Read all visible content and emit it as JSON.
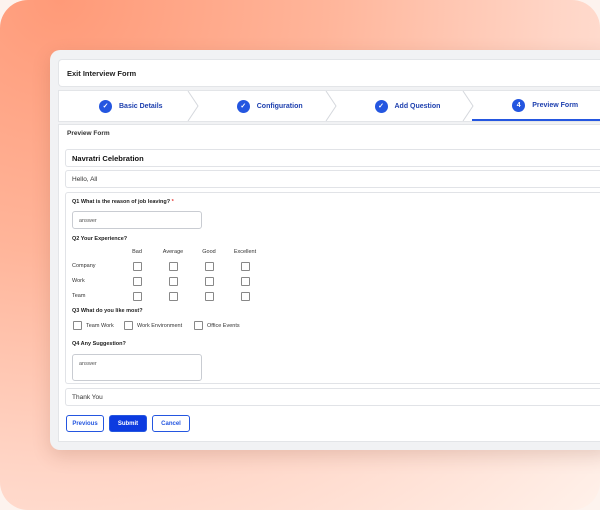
{
  "window": {
    "title": "Exit Interview Form"
  },
  "stepper": {
    "steps": [
      {
        "label": "Basic Details",
        "marker": "✓"
      },
      {
        "label": "Configuration",
        "marker": "✓"
      },
      {
        "label": "Add Question",
        "marker": "✓"
      },
      {
        "label": "Preview Form",
        "marker": "4"
      }
    ]
  },
  "preview": {
    "section_label": "Preview Form",
    "form_title": "Navratri Celebration",
    "greeting": "Hello, All",
    "closing": "Thank You",
    "q1": {
      "label": "Q1 What is the reason of job leaving?",
      "required_mark": "*",
      "placeholder": "answer"
    },
    "q2": {
      "label": "Q2 Your Experience?",
      "columns": [
        "Bad",
        "Average",
        "Good",
        "Excellent"
      ],
      "rows": [
        "Company",
        "Work",
        "Team"
      ]
    },
    "q3": {
      "label": "Q3 What do you like most?",
      "options": [
        "Team Work",
        "Work Environment",
        "Office Events"
      ]
    },
    "q4": {
      "label": "Q4 Any Suggestion?",
      "placeholder": "answer"
    }
  },
  "actions": {
    "previous": "Previous",
    "submit": "Submit",
    "cancel": "Cancel"
  },
  "colors": {
    "accent": "#2456e0",
    "primary_button": "#0c3be0",
    "background_gradient": "#ff9a78"
  }
}
